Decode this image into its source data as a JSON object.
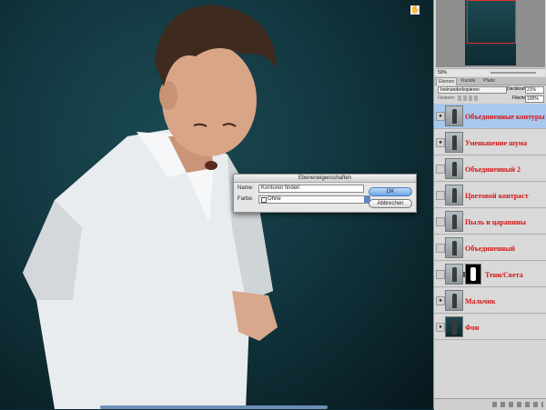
{
  "dialog": {
    "title": "Ebeneneigenschaften",
    "name_label": "Name:",
    "name_value": "Konturen finden",
    "color_label": "Farbe:",
    "color_value": "Ohne",
    "ok_label": "OK",
    "cancel_label": "Abbrechen"
  },
  "panel": {
    "zoom": "50%",
    "tabs": [
      "Ebenen",
      "Kanäle",
      "Pfade"
    ],
    "blend_mode": "Ineinanderkopieren",
    "opacity_label": "Deckkraft:",
    "opacity_value": "21%",
    "lock_label": "Fixieren:",
    "fill_label": "Fläche:",
    "fill_value": "100%"
  },
  "layers": [
    {
      "name": "Объединенные контуры",
      "visible": true,
      "selected": true,
      "mask": false
    },
    {
      "name": "Уменьшение шума",
      "visible": true,
      "selected": false,
      "mask": false
    },
    {
      "name": "Объединенный 2",
      "visible": false,
      "selected": false,
      "mask": false
    },
    {
      "name": "Цветовой контраст",
      "visible": false,
      "selected": false,
      "mask": false
    },
    {
      "name": "Пыль и царапины",
      "visible": false,
      "selected": false,
      "mask": false
    },
    {
      "name": "Объединенный",
      "visible": false,
      "selected": false,
      "mask": false
    },
    {
      "name": "Тени/Света",
      "visible": false,
      "selected": false,
      "mask": true
    },
    {
      "name": "Мальчик",
      "visible": true,
      "selected": false,
      "mask": false
    },
    {
      "name": "Фон",
      "visible": true,
      "selected": false,
      "mask": false
    }
  ],
  "colors": {
    "layer_name": "#d41414",
    "selected_layer": "#a8c8ee",
    "canvas_bg": "#143a43"
  }
}
